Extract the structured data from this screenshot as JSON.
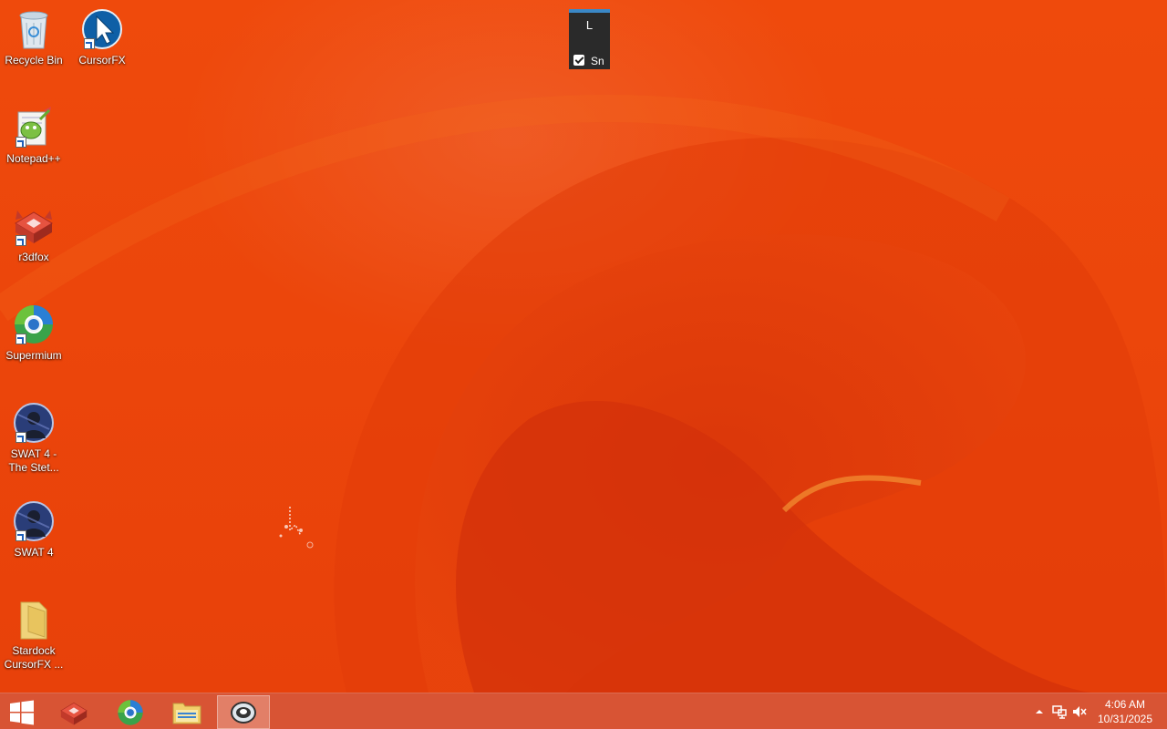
{
  "desktop": {
    "icons": [
      {
        "label": "Recycle Bin",
        "icon": "recycle-bin-icon"
      },
      {
        "label": "CursorFX",
        "icon": "cursorfx-icon"
      },
      {
        "label": "Notepad++",
        "icon": "notepadpp-icon"
      },
      {
        "label": "r3dfox",
        "icon": "r3dfox-icon"
      },
      {
        "label": "Supermium",
        "icon": "supermium-icon"
      },
      {
        "label": "SWAT 4 - The Stet...",
        "icon": "swat4-stetchkov-icon"
      },
      {
        "label": "SWAT 4",
        "icon": "swat4-icon"
      },
      {
        "label": "Stardock CursorFX ...",
        "icon": "folder-icon"
      }
    ]
  },
  "widget": {
    "title": "L",
    "checkbox_label": "Sn",
    "checked": true,
    "accent": "#3a88c7"
  },
  "taskbar": {
    "pinned": [
      {
        "name": "r3dfox",
        "icon": "r3dfox-icon"
      },
      {
        "name": "Supermium",
        "icon": "supermium-icon"
      },
      {
        "name": "File Explorer",
        "icon": "file-explorer-icon"
      },
      {
        "name": "CursorFX",
        "icon": "cursorfx-app-icon",
        "active": true
      }
    ],
    "tray": {
      "time": "4:06 AM",
      "date": "10/31/2025"
    }
  },
  "colors": {
    "wallpaper": "#e8430a",
    "taskbar": "#d65638"
  }
}
